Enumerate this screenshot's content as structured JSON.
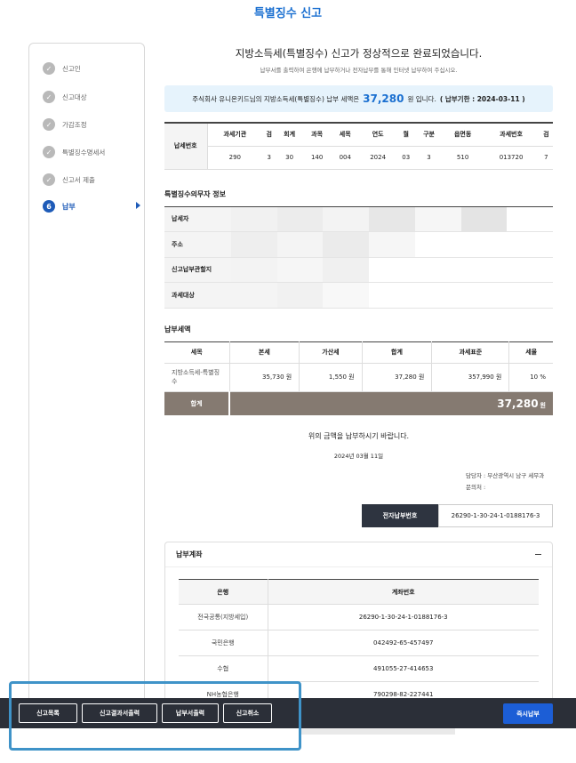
{
  "page_title": "특별징수 신고",
  "steps": [
    {
      "num": "✓",
      "label": "신고인",
      "active": false
    },
    {
      "num": "✓",
      "label": "신고대상",
      "active": false
    },
    {
      "num": "✓",
      "label": "가감조정",
      "active": false
    },
    {
      "num": "✓",
      "label": "특별징수명세서",
      "active": false
    },
    {
      "num": "✓",
      "label": "신고서 제출",
      "active": false
    },
    {
      "num": "6",
      "label": "납부",
      "active": true
    }
  ],
  "complete": {
    "title": "지방소득세(특별징수) 신고가 정상적으로 완료되었습니다.",
    "subtitle": "납부서를 출력하여 은행에 납부하거나 전자납부를 통해 인터넷 납부하여 주십시오."
  },
  "notice": {
    "prefix": "주식회사 유니온키드님의 지방소득세(특별징수) 납부 세액은",
    "amount": "37,280",
    "suffix": "원 입니다.",
    "due": "( 납부기한 : 2024-03-11 )"
  },
  "tax_number": {
    "row_label": "납세번호",
    "headers": [
      "과세기관",
      "검",
      "회계",
      "과목",
      "세목",
      "연도",
      "월",
      "구분",
      "읍면동",
      "과세번호",
      "검"
    ],
    "values": [
      "290",
      "3",
      "30",
      "140",
      "004",
      "2024",
      "03",
      "3",
      "510",
      "013720",
      "7"
    ]
  },
  "withholder": {
    "title": "특별징수의무자 정보",
    "rows": [
      "납세자",
      "주소",
      "신고납부관할지",
      "과세대상"
    ]
  },
  "payment": {
    "title": "납부세액",
    "headers": [
      "세목",
      "본세",
      "가산세",
      "합계",
      "과세표준",
      "세율"
    ],
    "row": {
      "item": "지방소득세-특별징수",
      "base": "35,730 원",
      "penalty": "1,550 원",
      "sum": "37,280 원",
      "standard": "357,990 원",
      "rate": "10 %"
    },
    "total_label": "합계",
    "total_value": "37,280",
    "total_unit": "원"
  },
  "request_text": "위의 금액을 납부하시기 바랍니다.",
  "request_date": "2024년 03월 11일",
  "staff": {
    "line1": "담당자 : 부산광역시 남구 세무과",
    "line2": "문의처 :"
  },
  "epay": {
    "label": "전자납부번호",
    "value": "26290-1-30-24-1-0188176-3"
  },
  "account": {
    "title": "납부계좌",
    "headers": [
      "은행",
      "계좌번호"
    ],
    "rows": [
      {
        "bank": "전국공통(지방세입)",
        "number": "26290-1-30-24-1-0188176-3"
      },
      {
        "bank": "국민은행",
        "number": "042492-65-457497"
      },
      {
        "bank": "수협",
        "number": "491055-27-414653"
      },
      {
        "bank": "NH농협은행",
        "number": "790298-82-227441"
      }
    ]
  },
  "bottom_buttons": [
    "신고목록",
    "신고결과서출력",
    "납부서출력",
    "신고취소"
  ],
  "pay_now_label": "즉시납부"
}
